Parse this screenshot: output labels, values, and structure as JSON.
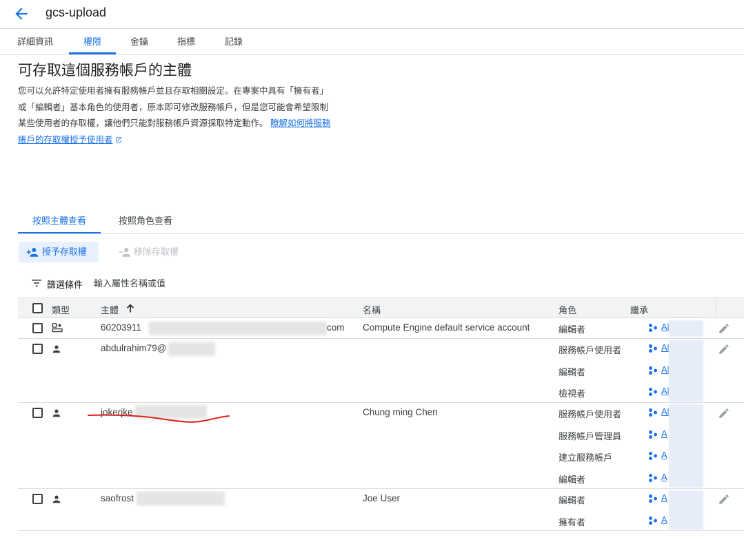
{
  "header": {
    "title": "gcs-upload"
  },
  "tabs": [
    {
      "label": "詳細資訊"
    },
    {
      "label": "權限"
    },
    {
      "label": "金鑰"
    },
    {
      "label": "指標"
    },
    {
      "label": "記錄"
    }
  ],
  "section": {
    "heading": "可存取這個服務帳戶的主體",
    "desc_line1": "您可以允許特定使用者擁有服務帳戶並且存取相關設定。在專案中具有「擁有者」",
    "desc_line2": "或「編輯者」基本角色的使用者，原本即可修改服務帳戶，但是您可能會希望限制",
    "desc_line3": "某些使用者的存取權，讓他們只能對服務帳戶資源採取特定動作。",
    "link_part1": "瞭解如何將服務",
    "link_part2": "帳戶的存取權授予使用者"
  },
  "subtabs": [
    {
      "label": "按照主體查看"
    },
    {
      "label": "按照角色查看"
    }
  ],
  "toolbar": {
    "grant_label": "授予存取權",
    "remove_label": "移除存取權"
  },
  "filter": {
    "label": "篩選條件",
    "placeholder": "輸入屬性名稱或值"
  },
  "table": {
    "headers": {
      "type": "類型",
      "principal": "主體",
      "name": "名稱",
      "role": "角色",
      "inherit": "繼承"
    },
    "rows": [
      {
        "type": "service-account",
        "principal_start": "60203911",
        "principal_end": "com",
        "name": "Compute Engine default service account",
        "roles": [
          "編輯者"
        ],
        "inherit": [
          "Al"
        ]
      },
      {
        "type": "user",
        "principal_start": "abdulrahim79@",
        "name": "",
        "roles": [
          "服務帳戶使用者",
          "編輯者",
          "檢視者"
        ],
        "inherit": [
          "Al",
          "Al",
          "Al"
        ]
      },
      {
        "type": "user",
        "principal_start": "jokerjke",
        "name": "Chung ming Chen",
        "roles": [
          "服務帳戶使用者",
          "服務帳戶管理員",
          "建立服務帳戶",
          "編輯者"
        ],
        "inherit": [
          "Al",
          "A",
          "A",
          "A"
        ]
      },
      {
        "type": "user",
        "principal_start": "saofrost",
        "name": "Joe User",
        "roles": [
          "編輯者",
          "擁有者"
        ],
        "inherit": [
          "A",
          "A"
        ]
      }
    ]
  },
  "colors": {
    "accent": "#1a73e8",
    "annotation": "#e0201c"
  }
}
